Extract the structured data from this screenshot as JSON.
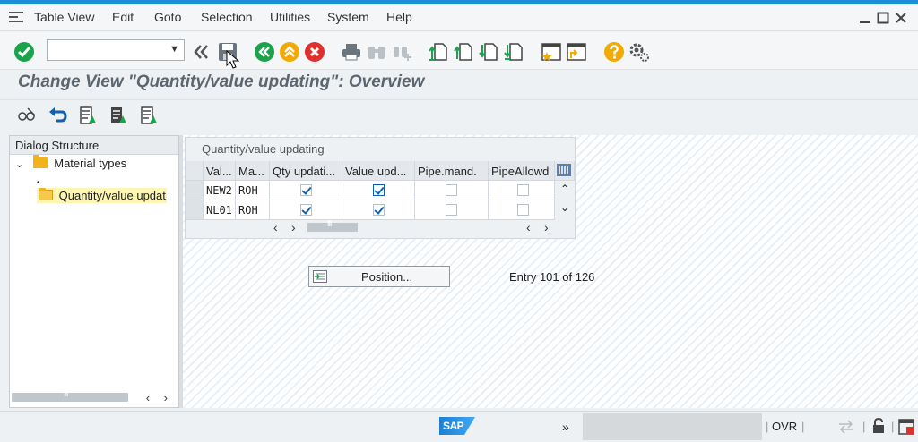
{
  "menu": {
    "items": [
      "Table View",
      "Edit",
      "Goto",
      "Selection",
      "Utilities",
      "System",
      "Help"
    ]
  },
  "toolbar": {
    "command_field_value": ""
  },
  "title": "Change View \"Quantity/value updating\": Overview",
  "dialog_structure": {
    "header": "Dialog Structure",
    "items": [
      "Material types",
      "Quantity/value updat"
    ]
  },
  "table": {
    "caption": "Quantity/value updating",
    "columns": [
      "Val...",
      "Ma...",
      "Qty updati...",
      "Value upd...",
      "Pipe.mand.",
      "PipeAllowd"
    ],
    "rows": [
      {
        "val": "NEW2",
        "ma": "ROH",
        "qty": true,
        "value": true,
        "pipe_mand": false,
        "pipe_allowed": false
      },
      {
        "val": "NL01",
        "ma": "ROH",
        "qty": true,
        "value": true,
        "pipe_mand": false,
        "pipe_allowed": false
      }
    ]
  },
  "position_button": "Position...",
  "entry_text": "Entry 101 of 126",
  "status": {
    "brand": "SAP",
    "mode": "OVR",
    "chevron": "»"
  },
  "colors": {
    "accent": "#1a8fd8",
    "ok_green": "#1aa34a",
    "cancel_red": "#e0302c",
    "nav_orange": "#f2a900"
  }
}
